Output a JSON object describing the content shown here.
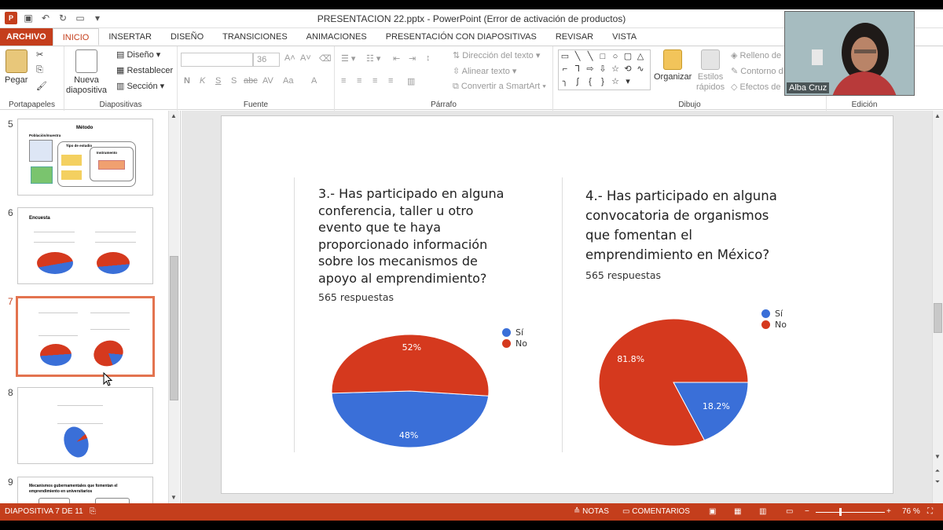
{
  "window": {
    "title": "PRESENTACION 22.pptx - PowerPoint (Error de activación de productos)",
    "app_badge": "P"
  },
  "tabs": [
    "ARCHIVO",
    "INICIO",
    "INSERTAR",
    "DISEÑO",
    "TRANSICIONES",
    "ANIMACIONES",
    "PRESENTACIÓN CON DIAPOSITIVAS",
    "REVISAR",
    "VISTA"
  ],
  "ribbon": {
    "portapapeles": {
      "label": "Portapapeles",
      "paste": "Pegar"
    },
    "diapositivas": {
      "label": "Diapositivas",
      "new_line1": "Nueva",
      "new_line2": "diapositiva",
      "layout": "Diseño",
      "reset": "Restablecer",
      "section": "Sección"
    },
    "fuente": {
      "label": "Fuente",
      "size": "36",
      "bold": "N",
      "italic": "K",
      "underline": "S",
      "shadow": "S",
      "strike": "abc",
      "spacing": "AV",
      "case": "Aa",
      "color": "A"
    },
    "parrafo": {
      "label": "Párrafo",
      "text_direction": "Dirección del texto",
      "align_text": "Alinear texto",
      "smartart": "Convertir a SmartArt"
    },
    "dibujo": {
      "label": "Dibujo",
      "arrange": "Organizar",
      "quick_styles_1": "Estilos",
      "quick_styles_2": "rápidos",
      "fill": "Relleno de",
      "outline": "Contorno d",
      "effects": "Efectos de"
    },
    "edicion": {
      "label": "Edición"
    }
  },
  "thumbnails": [
    {
      "num": "5",
      "title": "Método",
      "subtitle": "Población/muestra",
      "box1": "Tipo de estudio",
      "box2": "Instrumento"
    },
    {
      "num": "6",
      "title": "Encuesta"
    },
    {
      "num": "7"
    },
    {
      "num": "8"
    },
    {
      "num": "9",
      "title": "Mecanismos gubernamentales que fomentan el emprendimiento en universitarios"
    }
  ],
  "slide": {
    "q3": {
      "text": "3.- Has participado en alguna\nconferencia, taller u otro\nevento que te haya\nproporcionado información\nsobre los mecanismos de\napoyo al emprendimiento?",
      "responses": "565 respuestas"
    },
    "q4": {
      "text": "4.- Has participado en alguna\nconvocatoria de organismos\nque fomentan el\nemprendimiento en México?",
      "responses": "565 respuestas"
    }
  },
  "chart_data": [
    {
      "type": "pie",
      "categories": [
        "Sí",
        "No"
      ],
      "values": [
        48,
        52
      ],
      "labels": [
        "48%",
        "52%"
      ],
      "colors": [
        "#3a6fd8",
        "#d5391e"
      ],
      "legend": "right"
    },
    {
      "type": "pie",
      "categories": [
        "Sí",
        "No"
      ],
      "values": [
        18.2,
        81.8
      ],
      "labels": [
        "18.2%",
        "81.8%"
      ],
      "colors": [
        "#3a6fd8",
        "#d5391e"
      ],
      "legend": "right"
    }
  ],
  "statusbar": {
    "slide_of": "DIAPOSITIVA 7 DE 11",
    "notes": "NOTAS",
    "comments": "COMENTARIOS",
    "zoom": "76 %"
  },
  "webcam": {
    "name": "Alba Cruz"
  },
  "colors": {
    "accent": "#c43e1c",
    "blue": "#3a6fd8",
    "red": "#d5391e"
  }
}
